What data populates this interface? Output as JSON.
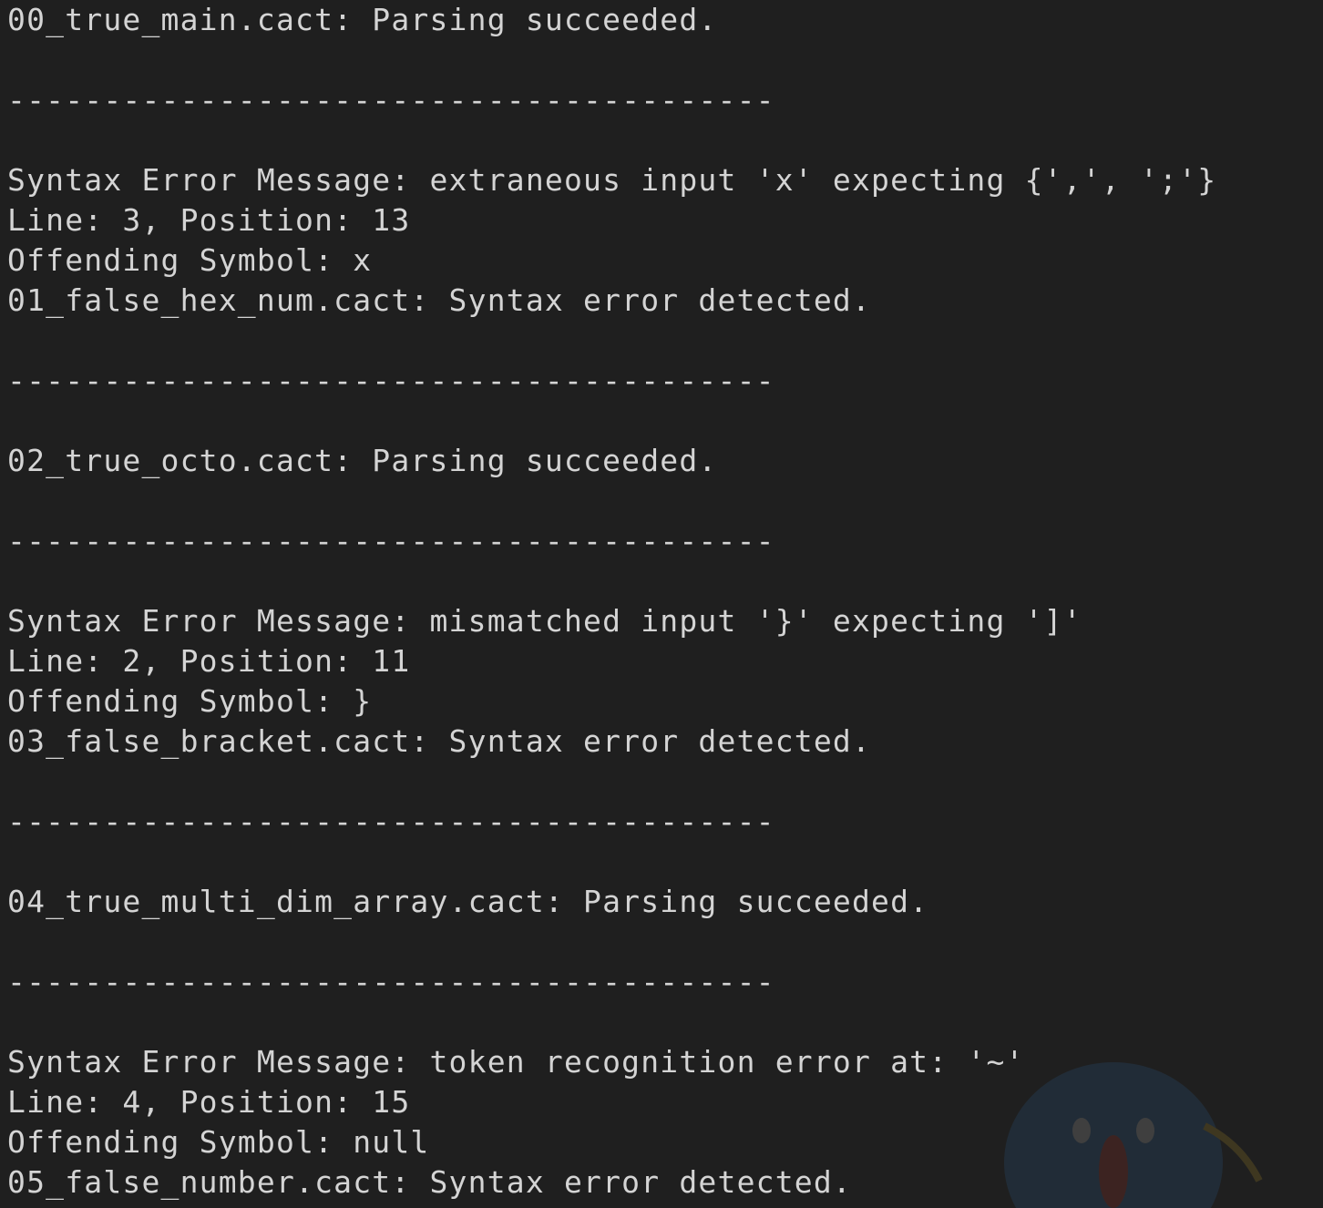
{
  "terminal": {
    "lines": [
      "00_true_main.cact: Parsing succeeded.",
      "",
      "----------------------------------------",
      "",
      "Syntax Error Message: extraneous input 'x' expecting {',', ';'}",
      "Line: 3, Position: 13",
      "Offending Symbol: x",
      "01_false_hex_num.cact: Syntax error detected.",
      "",
      "----------------------------------------",
      "",
      "02_true_octo.cact: Parsing succeeded.",
      "",
      "----------------------------------------",
      "",
      "Syntax Error Message: mismatched input '}' expecting ']'",
      "Line: 2, Position: 11",
      "Offending Symbol: }",
      "03_false_bracket.cact: Syntax error detected.",
      "",
      "----------------------------------------",
      "",
      "04_true_multi_dim_array.cact: Parsing succeeded.",
      "",
      "----------------------------------------",
      "",
      "Syntax Error Message: token recognition error at: '~'",
      "Line: 4, Position: 15",
      "Offending Symbol: null",
      "05_false_number.cact: Syntax error detected."
    ]
  },
  "colors": {
    "background": "#1f1f1f",
    "text": "#d4d4d4"
  }
}
